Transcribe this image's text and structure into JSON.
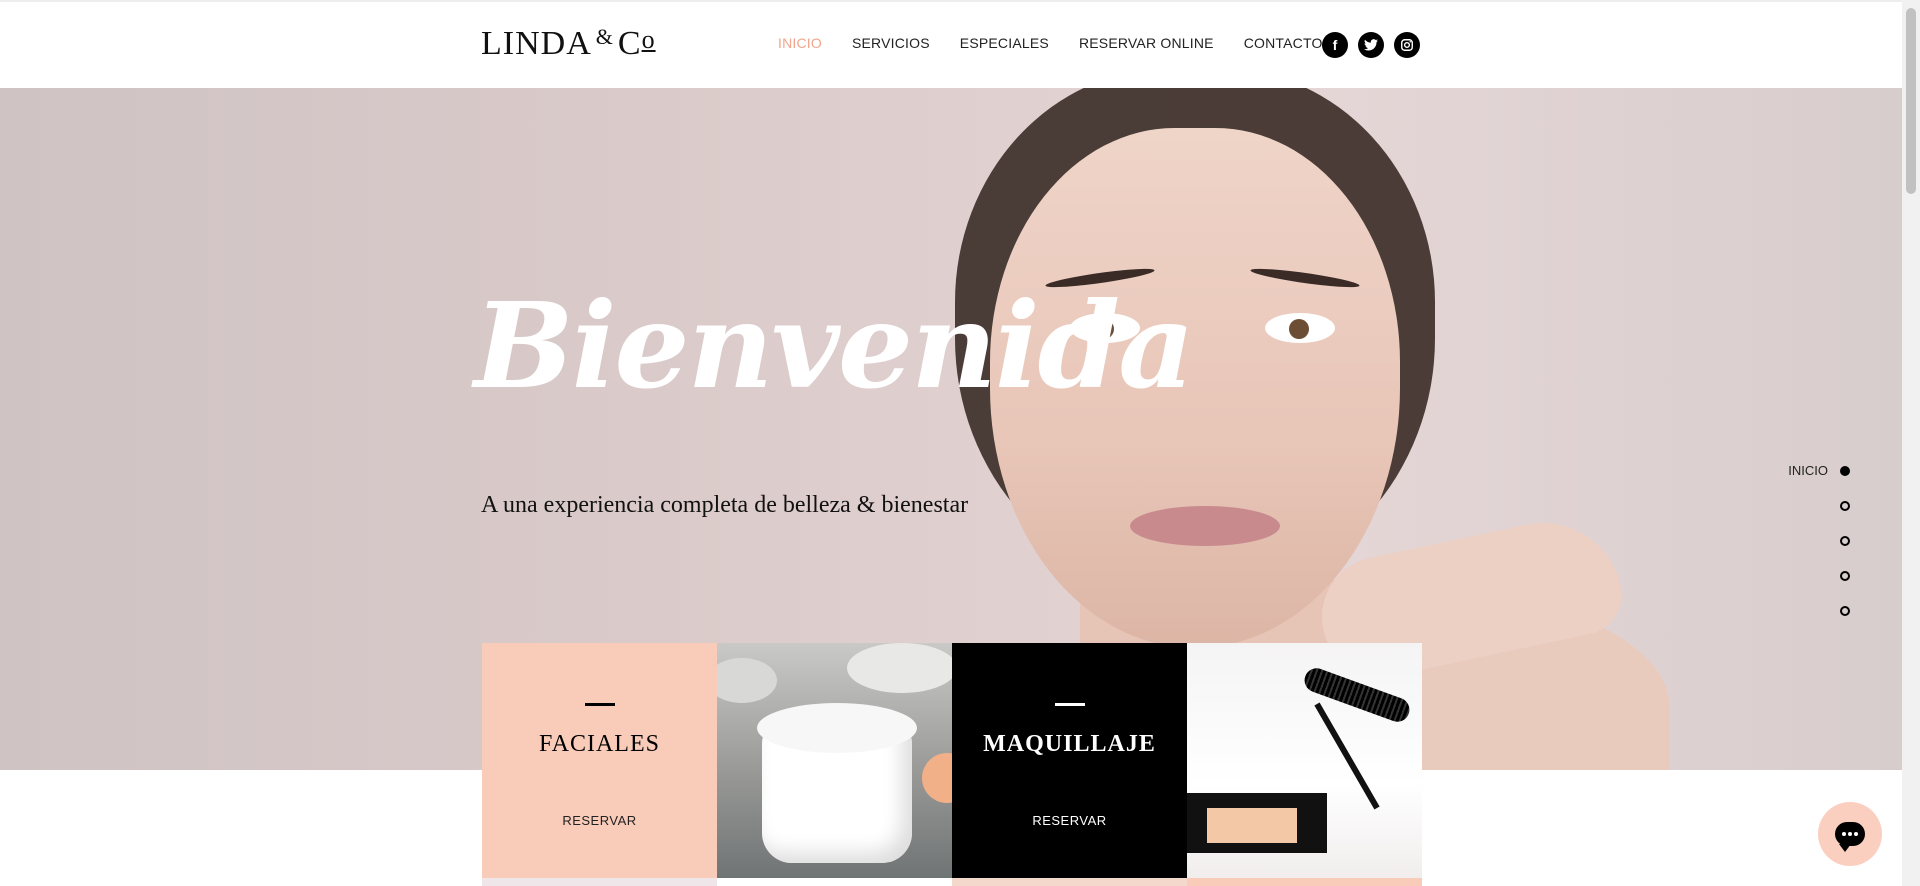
{
  "header": {
    "logo_main": "LINDA",
    "logo_amp": "&",
    "logo_c": "C",
    "logo_o": "o",
    "nav": [
      "INICIO",
      "SERVICIOS",
      "ESPECIALES",
      "RESERVAR ONLINE",
      "CONTACTO"
    ],
    "active_nav": "INICIO",
    "social_icons": [
      "facebook-icon",
      "twitter-icon",
      "instagram-icon"
    ]
  },
  "hero": {
    "title": "Bienvenida",
    "subtitle": "A una experiencia completa de belleza & bienestar"
  },
  "section_nav": {
    "active_label": "INICIO",
    "count": 5
  },
  "tiles": [
    {
      "title": "FACIALES",
      "action": "RESERVAR"
    },
    {
      "title": "MAQUILLAJE",
      "action": "RESERVAR"
    }
  ],
  "colors": {
    "accent_peach": "#f9cbb9",
    "active_nav": "#f0a58c",
    "black": "#000000"
  }
}
